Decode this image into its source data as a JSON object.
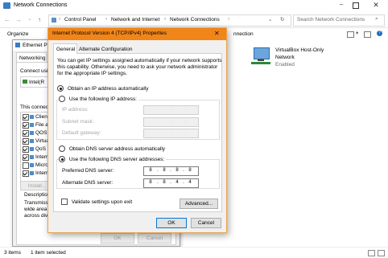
{
  "window": {
    "title": "Network Connections"
  },
  "address": {
    "crumbs": [
      "Control Panel",
      "Network and Internet",
      "Network Connections"
    ],
    "search_placeholder": "Search Network Connections"
  },
  "cmdbar": {
    "organize": "Organize",
    "partial": "nnection"
  },
  "status": {
    "items": "3 items",
    "selected": "1 item selected"
  },
  "adapter": {
    "name": "VirtualBox Host-Only",
    "line2": "Network",
    "state": "Enabled"
  },
  "eth": {
    "title": "Ethernet Pr",
    "tab": "Networking",
    "connect_label": "Connect using:",
    "device": "Intel(R",
    "items_label": "This connect",
    "items": [
      {
        "label": "Clien",
        "checked": true
      },
      {
        "label": "File a",
        "checked": true
      },
      {
        "label": "QOS",
        "checked": true
      },
      {
        "label": "Virtua",
        "checked": true
      },
      {
        "label": "QoS",
        "checked": true
      },
      {
        "label": "Interr",
        "checked": true
      },
      {
        "label": "Micro",
        "checked": false
      },
      {
        "label": "Interr",
        "checked": true
      }
    ],
    "install": "Install...",
    "description_label": "Description",
    "description": [
      "Transmissi",
      "wide area n",
      "across dive"
    ],
    "ok": "OK",
    "cancel": "Cancel"
  },
  "ipv4": {
    "title": "Internet Protocol Version 4 (TCP/IPv4) Properties",
    "tabs": {
      "general": "General",
      "alternate": "Alternate Configuration"
    },
    "intro": [
      "You can get IP settings assigned automatically if your network supports",
      "this capability. Otherwise, you need to ask your network administrator",
      "for the appropriate IP settings."
    ],
    "obtain_ip_auto": "Obtain an IP address automatically",
    "use_following_ip": "Use the following IP address:",
    "ip_address": "IP address:",
    "subnet_mask": "Subnet mask:",
    "default_gateway": "Default gateway:",
    "obtain_dns_auto": "Obtain DNS server address automatically",
    "use_following_dns": "Use the following DNS server addresses:",
    "preferred_dns": "Preferred DNS server:",
    "alternate_dns": "Alternate DNS server:",
    "preferred_dns_value": [
      "8",
      "8",
      "8",
      "8"
    ],
    "alternate_dns_value": [
      "8",
      "8",
      "4",
      "4"
    ],
    "validate": "Validate settings upon exit",
    "advanced": "Advanced...",
    "ok": "OK",
    "cancel": "Cancel"
  },
  "colors": {
    "accent_title": "#f0851a",
    "selection": "#cce8ff"
  }
}
